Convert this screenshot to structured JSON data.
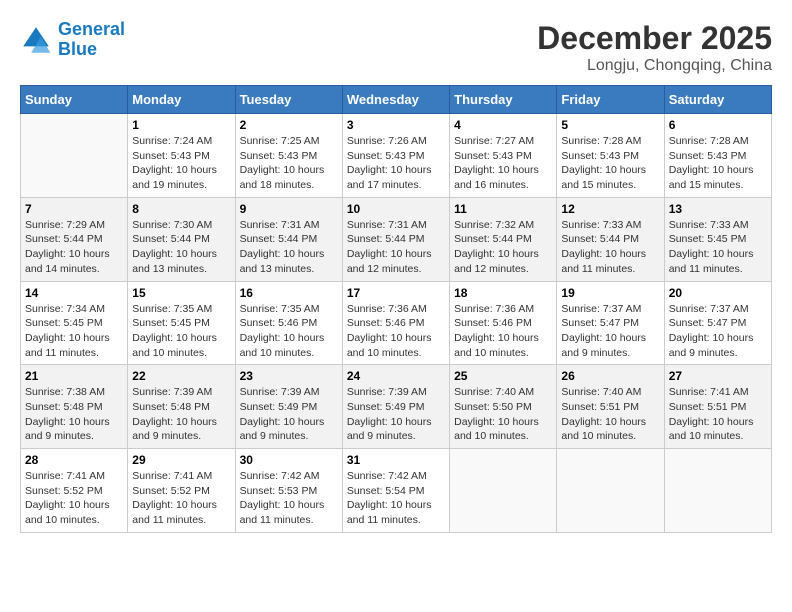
{
  "logo": {
    "line1": "General",
    "line2": "Blue"
  },
  "title": "December 2025",
  "location": "Longju, Chongqing, China",
  "days_of_week": [
    "Sunday",
    "Monday",
    "Tuesday",
    "Wednesday",
    "Thursday",
    "Friday",
    "Saturday"
  ],
  "weeks": [
    [
      {
        "day": "",
        "info": ""
      },
      {
        "day": "1",
        "info": "Sunrise: 7:24 AM\nSunset: 5:43 PM\nDaylight: 10 hours\nand 19 minutes."
      },
      {
        "day": "2",
        "info": "Sunrise: 7:25 AM\nSunset: 5:43 PM\nDaylight: 10 hours\nand 18 minutes."
      },
      {
        "day": "3",
        "info": "Sunrise: 7:26 AM\nSunset: 5:43 PM\nDaylight: 10 hours\nand 17 minutes."
      },
      {
        "day": "4",
        "info": "Sunrise: 7:27 AM\nSunset: 5:43 PM\nDaylight: 10 hours\nand 16 minutes."
      },
      {
        "day": "5",
        "info": "Sunrise: 7:28 AM\nSunset: 5:43 PM\nDaylight: 10 hours\nand 15 minutes."
      },
      {
        "day": "6",
        "info": "Sunrise: 7:28 AM\nSunset: 5:43 PM\nDaylight: 10 hours\nand 15 minutes."
      }
    ],
    [
      {
        "day": "7",
        "info": "Sunrise: 7:29 AM\nSunset: 5:44 PM\nDaylight: 10 hours\nand 14 minutes."
      },
      {
        "day": "8",
        "info": "Sunrise: 7:30 AM\nSunset: 5:44 PM\nDaylight: 10 hours\nand 13 minutes."
      },
      {
        "day": "9",
        "info": "Sunrise: 7:31 AM\nSunset: 5:44 PM\nDaylight: 10 hours\nand 13 minutes."
      },
      {
        "day": "10",
        "info": "Sunrise: 7:31 AM\nSunset: 5:44 PM\nDaylight: 10 hours\nand 12 minutes."
      },
      {
        "day": "11",
        "info": "Sunrise: 7:32 AM\nSunset: 5:44 PM\nDaylight: 10 hours\nand 12 minutes."
      },
      {
        "day": "12",
        "info": "Sunrise: 7:33 AM\nSunset: 5:44 PM\nDaylight: 10 hours\nand 11 minutes."
      },
      {
        "day": "13",
        "info": "Sunrise: 7:33 AM\nSunset: 5:45 PM\nDaylight: 10 hours\nand 11 minutes."
      }
    ],
    [
      {
        "day": "14",
        "info": "Sunrise: 7:34 AM\nSunset: 5:45 PM\nDaylight: 10 hours\nand 11 minutes."
      },
      {
        "day": "15",
        "info": "Sunrise: 7:35 AM\nSunset: 5:45 PM\nDaylight: 10 hours\nand 10 minutes."
      },
      {
        "day": "16",
        "info": "Sunrise: 7:35 AM\nSunset: 5:46 PM\nDaylight: 10 hours\nand 10 minutes."
      },
      {
        "day": "17",
        "info": "Sunrise: 7:36 AM\nSunset: 5:46 PM\nDaylight: 10 hours\nand 10 minutes."
      },
      {
        "day": "18",
        "info": "Sunrise: 7:36 AM\nSunset: 5:46 PM\nDaylight: 10 hours\nand 10 minutes."
      },
      {
        "day": "19",
        "info": "Sunrise: 7:37 AM\nSunset: 5:47 PM\nDaylight: 10 hours\nand 9 minutes."
      },
      {
        "day": "20",
        "info": "Sunrise: 7:37 AM\nSunset: 5:47 PM\nDaylight: 10 hours\nand 9 minutes."
      }
    ],
    [
      {
        "day": "21",
        "info": "Sunrise: 7:38 AM\nSunset: 5:48 PM\nDaylight: 10 hours\nand 9 minutes."
      },
      {
        "day": "22",
        "info": "Sunrise: 7:39 AM\nSunset: 5:48 PM\nDaylight: 10 hours\nand 9 minutes."
      },
      {
        "day": "23",
        "info": "Sunrise: 7:39 AM\nSunset: 5:49 PM\nDaylight: 10 hours\nand 9 minutes."
      },
      {
        "day": "24",
        "info": "Sunrise: 7:39 AM\nSunset: 5:49 PM\nDaylight: 10 hours\nand 9 minutes."
      },
      {
        "day": "25",
        "info": "Sunrise: 7:40 AM\nSunset: 5:50 PM\nDaylight: 10 hours\nand 10 minutes."
      },
      {
        "day": "26",
        "info": "Sunrise: 7:40 AM\nSunset: 5:51 PM\nDaylight: 10 hours\nand 10 minutes."
      },
      {
        "day": "27",
        "info": "Sunrise: 7:41 AM\nSunset: 5:51 PM\nDaylight: 10 hours\nand 10 minutes."
      }
    ],
    [
      {
        "day": "28",
        "info": "Sunrise: 7:41 AM\nSunset: 5:52 PM\nDaylight: 10 hours\nand 10 minutes."
      },
      {
        "day": "29",
        "info": "Sunrise: 7:41 AM\nSunset: 5:52 PM\nDaylight: 10 hours\nand 11 minutes."
      },
      {
        "day": "30",
        "info": "Sunrise: 7:42 AM\nSunset: 5:53 PM\nDaylight: 10 hours\nand 11 minutes."
      },
      {
        "day": "31",
        "info": "Sunrise: 7:42 AM\nSunset: 5:54 PM\nDaylight: 10 hours\nand 11 minutes."
      },
      {
        "day": "",
        "info": ""
      },
      {
        "day": "",
        "info": ""
      },
      {
        "day": "",
        "info": ""
      }
    ]
  ]
}
